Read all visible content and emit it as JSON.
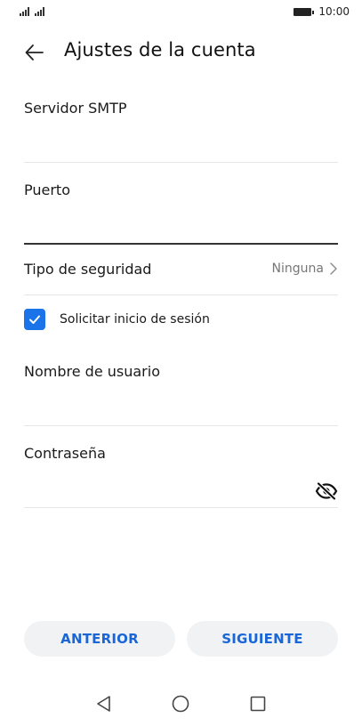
{
  "status_bar": {
    "signal_icons": [
      "signal-icon",
      "signal-icon"
    ],
    "battery_icon": "battery-icon",
    "time": "10:00"
  },
  "header": {
    "back_icon": "arrow-left-icon",
    "title": "Ajustes de la cuenta"
  },
  "form": {
    "smtp_server": {
      "label": "Servidor SMTP",
      "value": ""
    },
    "port": {
      "label": "Puerto",
      "value": ""
    },
    "security_type": {
      "label": "Tipo de seguridad",
      "value": "Ninguna",
      "icon": "chevron-right-icon"
    },
    "require_signin": {
      "label": "Solicitar inicio de sesión",
      "checked": true
    },
    "username": {
      "label": "Nombre de usuario",
      "value": ""
    },
    "password": {
      "label": "Contraseña",
      "value": "",
      "icon": "eye-off-icon"
    }
  },
  "buttons": {
    "previous": "ANTERIOR",
    "next": "SIGUIENTE"
  },
  "nav_bar": {
    "back_icon": "nav-back-icon",
    "home_icon": "nav-home-icon",
    "recents_icon": "nav-recents-icon"
  },
  "colors": {
    "accent": "#1a73e8",
    "button_text": "#1a66d6",
    "button_bg": "#f1f2f4"
  }
}
